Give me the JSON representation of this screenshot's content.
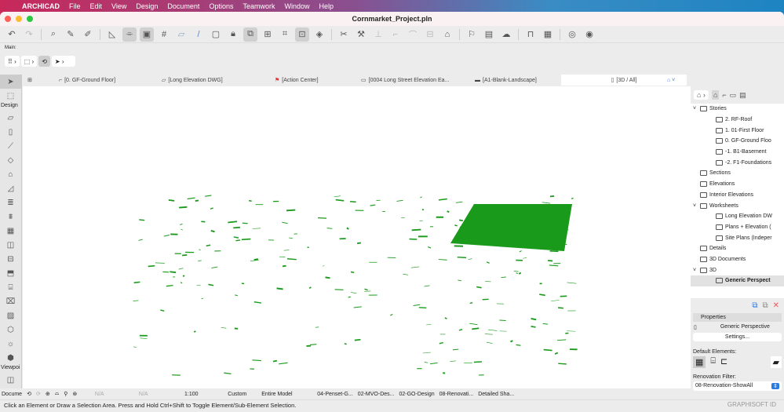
{
  "menubar": {
    "app": "ARCHICAD",
    "items": [
      "File",
      "Edit",
      "View",
      "Design",
      "Document",
      "Options",
      "Teamwork",
      "Window",
      "Help"
    ]
  },
  "window": {
    "title": "Cornmarket_Project.pln"
  },
  "toolbar": {
    "main_label": "Main:"
  },
  "tabs": [
    {
      "label": "[0. GF-Ground Floor]",
      "icon": "floorplan-icon"
    },
    {
      "label": "[Long Elevation DWG]",
      "icon": "worksheet-icon"
    },
    {
      "label": "[Action Center]",
      "icon": "action-center-icon"
    },
    {
      "label": "[0004 Long Street Elevation Ea...",
      "icon": "layout-icon"
    },
    {
      "label": "[A1-Blank-Landscape]",
      "icon": "master-layout-icon"
    },
    {
      "label": "[3D / All]",
      "icon": "3d-icon"
    }
  ],
  "toolbox": {
    "design": "Design",
    "viewpoint": "Viewpoi",
    "document": "Docume"
  },
  "navigator": {
    "items": [
      {
        "label": "Stories",
        "level": 0,
        "exp": true
      },
      {
        "label": "2. RF-Roof",
        "level": 1
      },
      {
        "label": "1. 01-First Floor",
        "level": 1
      },
      {
        "label": "0. GF-Ground Floo",
        "level": 1
      },
      {
        "label": "-1. B1-Basement",
        "level": 1
      },
      {
        "label": "-2. F1-Foundations",
        "level": 1
      },
      {
        "label": "Sections",
        "level": 0
      },
      {
        "label": "Elevations",
        "level": 0
      },
      {
        "label": "Interior Elevations",
        "level": 0
      },
      {
        "label": "Worksheets",
        "level": 0,
        "exp": true
      },
      {
        "label": "Long Elevation DW",
        "level": 1
      },
      {
        "label": "Plans + Elevation (",
        "level": 1
      },
      {
        "label": "Site Plans (Indeper",
        "level": 1
      },
      {
        "label": "Details",
        "level": 0
      },
      {
        "label": "3D Documents",
        "level": 0
      },
      {
        "label": "3D",
        "level": 0,
        "exp": true
      },
      {
        "label": "Generic Perspect",
        "level": 1,
        "selected": true
      }
    ]
  },
  "properties": {
    "header": "Properties",
    "view_name": "Generic Perspective",
    "settings": "Settings...",
    "default_elements": "Default Elements:",
    "renovation_filter_label": "Renovation Filter:",
    "renovation_filter_value": "08-Renovation-ShowAll",
    "graphisoft": "GRAPHISOFT ID"
  },
  "statusbar": {
    "items": [
      "N/A",
      "N/A",
      "1:100",
      "Custom",
      "Entire Model",
      "04-Penset-G...",
      "02-MVO-Des...",
      "02-GO-Design",
      "08-Renovati...",
      "Detailed Sha..."
    ]
  },
  "hint": "Click an Element or Draw a Selection Area. Press and Hold Ctrl+Shift to Toggle Element/Sub-Element Selection.",
  "colors": {
    "model": "#1a9a1a",
    "accent": "#2a7ae2"
  }
}
